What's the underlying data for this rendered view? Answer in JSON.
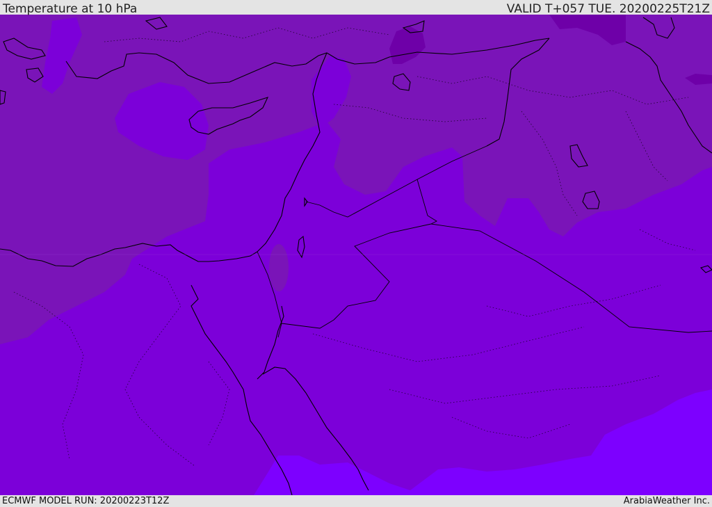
{
  "header": {
    "title": "Temperature at 10 hPa",
    "valid": "VALID T+057 TUE. 20200225T21Z"
  },
  "footer": {
    "model_run": "ECMWF MODEL RUN: 20200223T12Z",
    "credit": "ArabiaWeather Inc."
  },
  "colors": {
    "band_warm": "#7a14b8",
    "band_mid": "#7c00d9",
    "band_cool": "#7d00ff",
    "band_dark": "#6e00a8",
    "bars": "#e4e4e4",
    "coastline": "#000000"
  }
}
